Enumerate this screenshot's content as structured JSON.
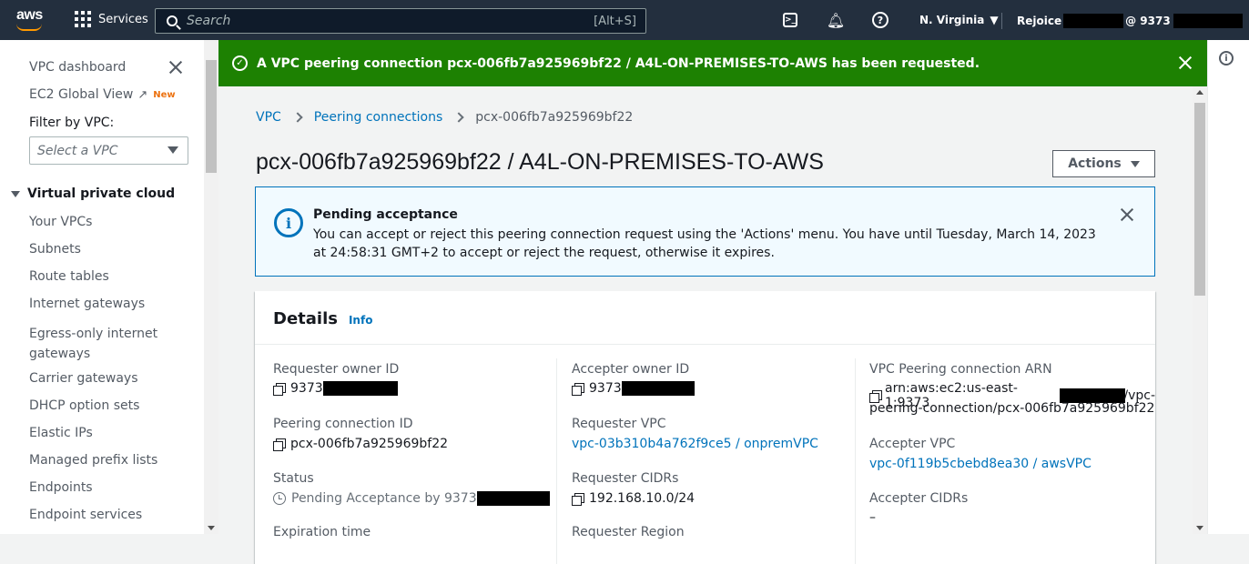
{
  "topnav": {
    "logo": "aws",
    "services": "Services",
    "search_placeholder": "Search",
    "search_shortcut": "[Alt+S]",
    "region": "N. Virginia",
    "account_prefix": "Rejoice",
    "account_suffix": "@ 9373"
  },
  "sidebar": {
    "dashboard": "VPC dashboard",
    "global_view": "EC2 Global View",
    "new_badge": "New",
    "filter_label": "Filter by VPC:",
    "select_placeholder": "Select a VPC",
    "section": "Virtual private cloud",
    "items": [
      "Your VPCs",
      "Subnets",
      "Route tables",
      "Internet gateways",
      "Egress-only internet gateways",
      "Carrier gateways",
      "DHCP option sets",
      "Elastic IPs",
      "Managed prefix lists",
      "Endpoints",
      "Endpoint services"
    ]
  },
  "flash": {
    "message": "A VPC peering connection pcx-006fb7a925969bf22 / A4L-ON-PREMISES-TO-AWS has been requested."
  },
  "breadcrumb": {
    "root": "VPC",
    "parent": "Peering connections",
    "current": "pcx-006fb7a925969bf22"
  },
  "page": {
    "title": "pcx-006fb7a925969bf22 / A4L-ON-PREMISES-TO-AWS",
    "actions": "Actions"
  },
  "alert": {
    "title": "Pending acceptance",
    "body": "You can accept or reject this peering connection request using the 'Actions' menu. You have until Tuesday, March 14, 2023 at 24:58:31 GMT+2 to accept or reject the request, otherwise it expires."
  },
  "details": {
    "heading": "Details",
    "info": "Info",
    "col1": {
      "requester_owner_label": "Requester owner ID",
      "requester_owner_value": "9373",
      "peering_id_label": "Peering connection ID",
      "peering_id_value": "pcx-006fb7a925969bf22",
      "status_label": "Status",
      "status_value": "Pending Acceptance by 9373",
      "expiration_label": "Expiration time"
    },
    "col2": {
      "accepter_owner_label": "Accepter owner ID",
      "accepter_owner_value": "9373",
      "requester_vpc_label": "Requester VPC",
      "requester_vpc_value": "vpc-03b310b4a762f9ce5 / onpremVPC",
      "requester_cidrs_label": "Requester CIDRs",
      "requester_cidrs_value": "192.168.10.0/24",
      "requester_region_label": "Requester Region"
    },
    "col3": {
      "arn_label": "VPC Peering connection ARN",
      "arn_value_start": "arn:aws:ec2:us-east-1:9373",
      "arn_value_end": "/vpc-",
      "arn_value_line2": "peering-connection/pcx-006fb7a925969bf22",
      "accepter_vpc_label": "Accepter VPC",
      "accepter_vpc_value": "vpc-0f119b5cbebd8ea30 / awsVPC",
      "accepter_cidrs_label": "Accepter CIDRs",
      "accepter_cidrs_value": "–"
    }
  }
}
